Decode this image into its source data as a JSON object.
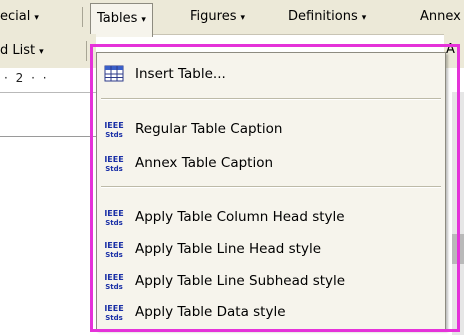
{
  "menubar": {
    "special_label": "ecial",
    "tables_label": "Tables",
    "figures_label": "Figures",
    "definitions_label": "Definitions",
    "annex_label": "Annex",
    "arrow": "▾"
  },
  "toolbar2": {
    "list_label": "d List",
    "arrow": "▾",
    "right_fragment": "A"
  },
  "ruler": {
    "text": "· 2 · ·"
  },
  "tables_menu": {
    "items": [
      {
        "label": "Insert Table...",
        "icon": "table-grid-icon"
      },
      {
        "label": "Regular Table Caption",
        "icon": "ieee-stds-icon"
      },
      {
        "label": "Annex Table Caption",
        "icon": "ieee-stds-icon"
      },
      {
        "label": "Apply Table Column Head style",
        "icon": "ieee-stds-icon"
      },
      {
        "label": "Apply Table Line Head style",
        "icon": "ieee-stds-icon"
      },
      {
        "label": "Apply Table Line Subhead style",
        "icon": "ieee-stds-icon"
      },
      {
        "label": "Apply Table Data style",
        "icon": "ieee-stds-icon"
      }
    ],
    "icon_text": {
      "top": "IEEE",
      "bottom": "Stds"
    }
  },
  "colors": {
    "highlight": "#e532d9",
    "menu_bg": "#f6f4ec",
    "bar_bg": "#ece9d8",
    "ieee_blue": "#1a2fa6"
  }
}
